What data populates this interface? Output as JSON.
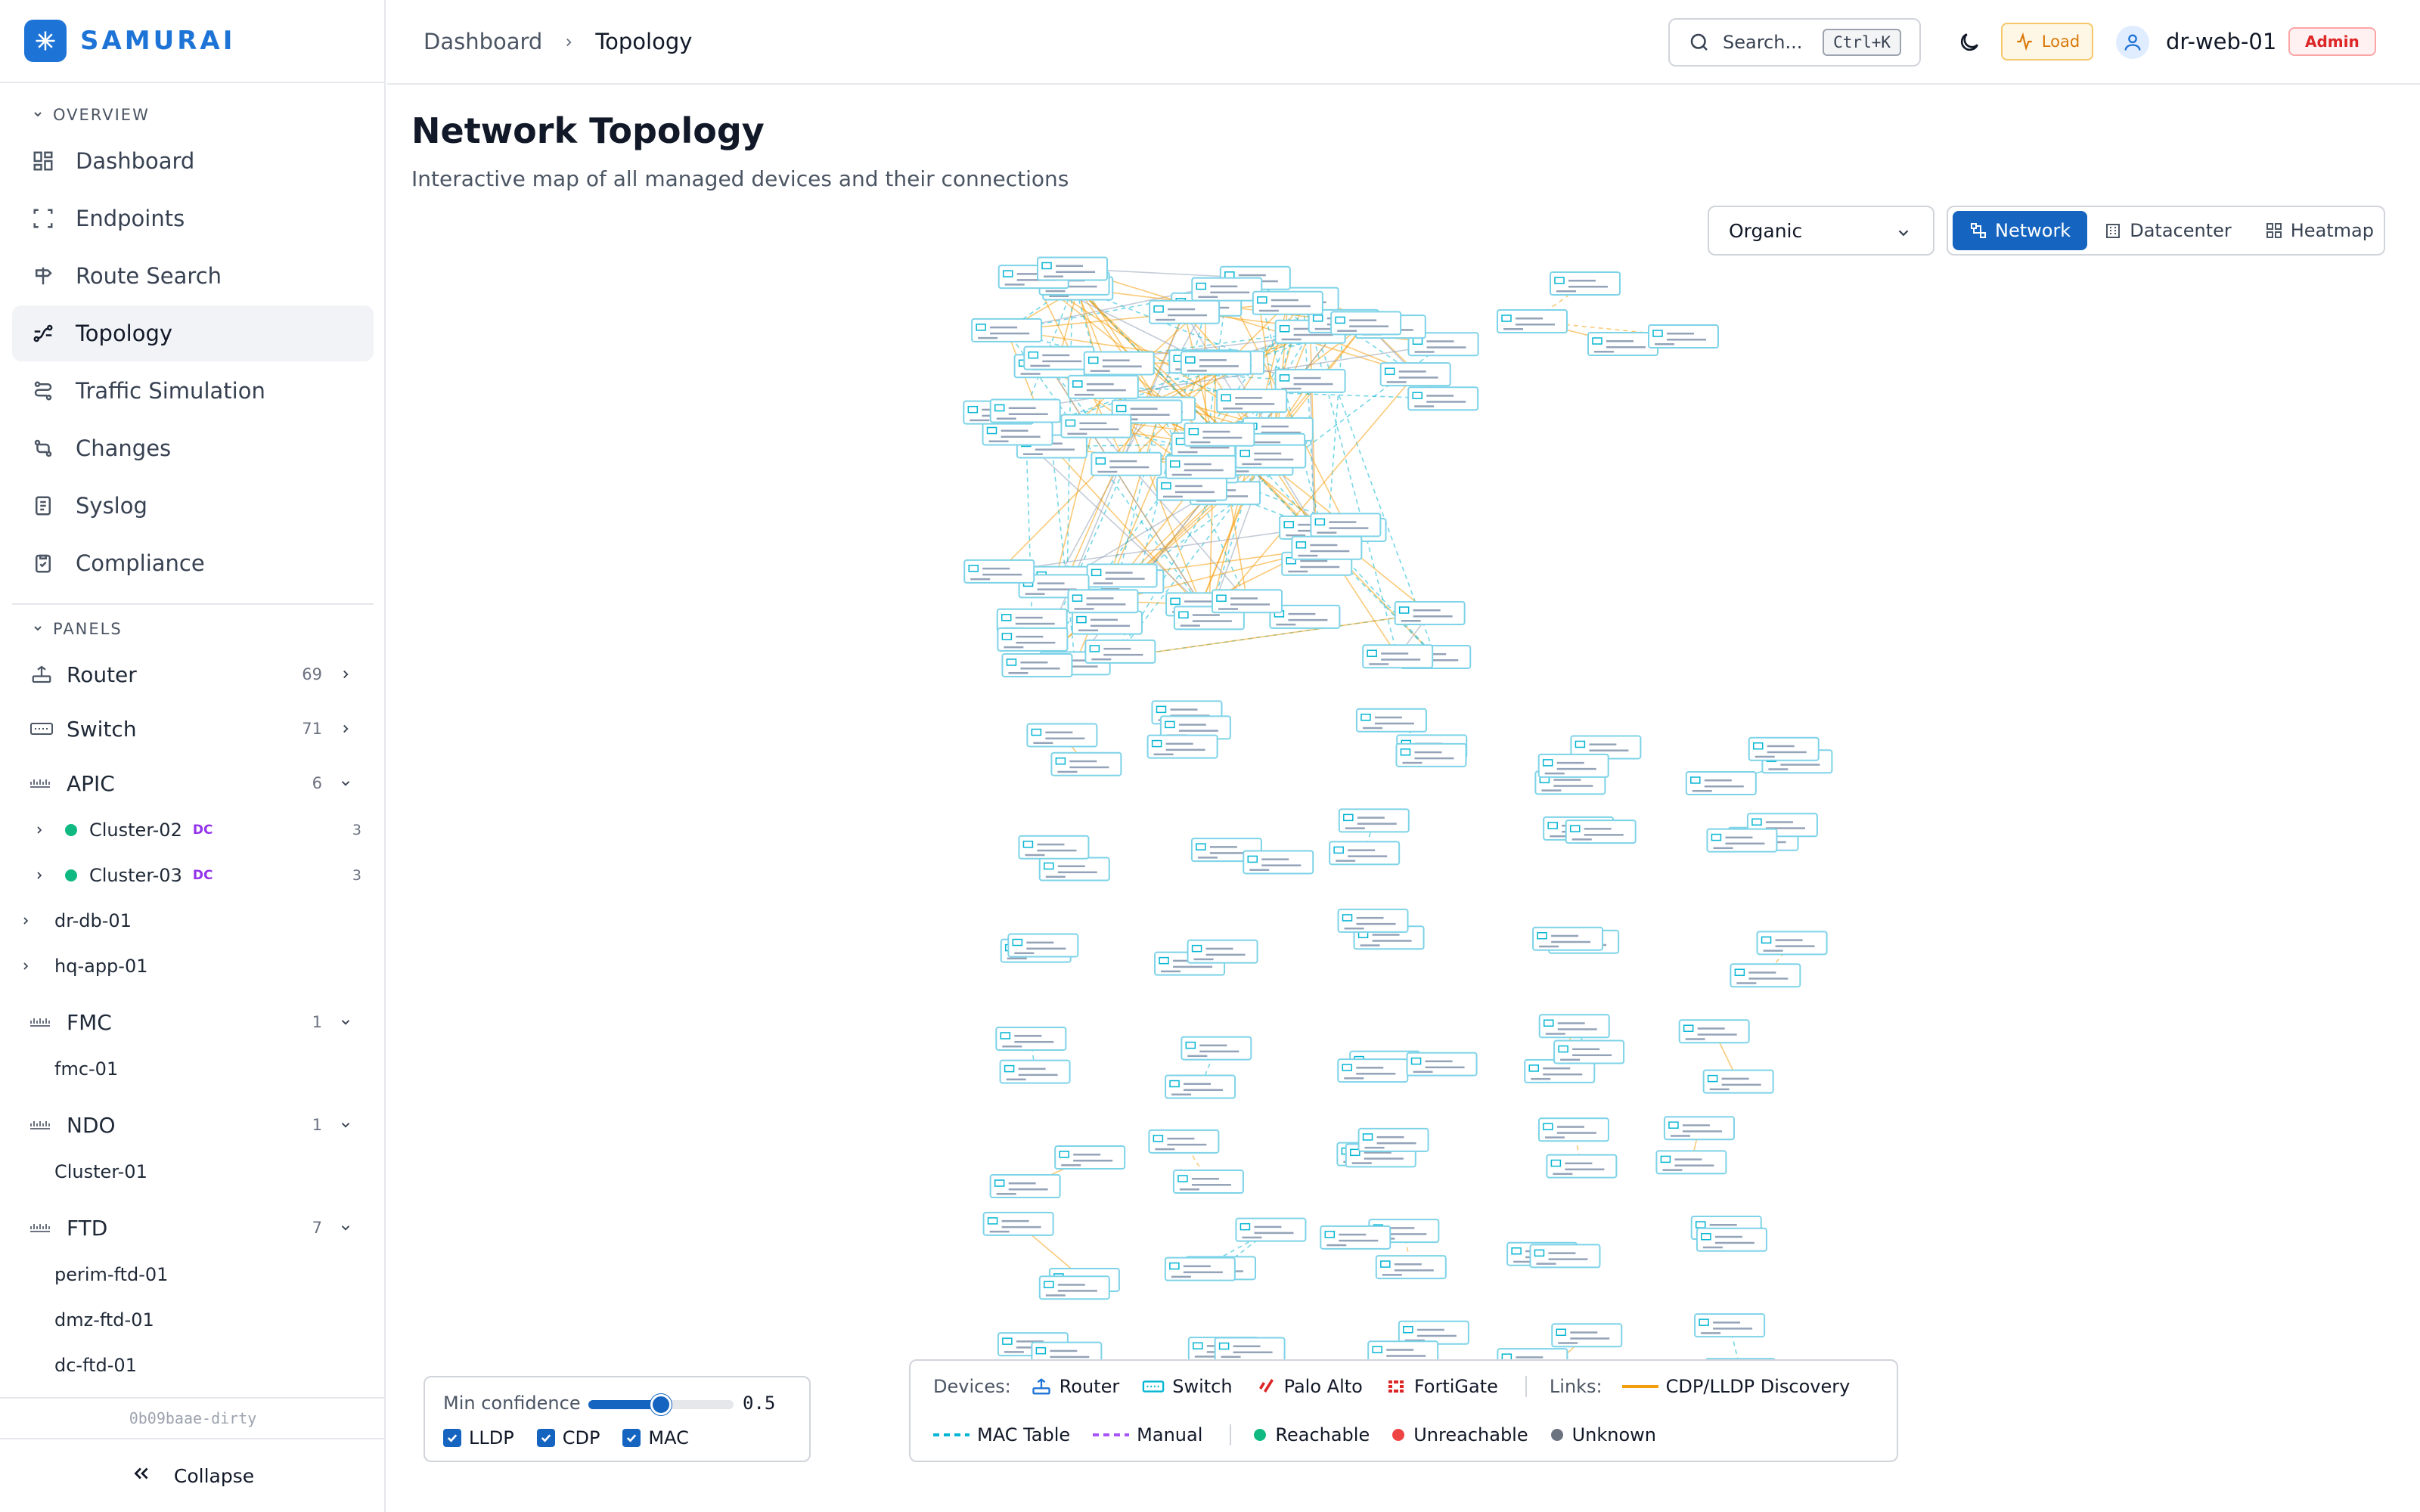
{
  "brand": {
    "name": "SAMURAI",
    "color": "#1e74d6"
  },
  "sidebar": {
    "overview_label": "OVERVIEW",
    "nav": [
      {
        "label": "Dashboard",
        "icon": "dashboard-grid-icon"
      },
      {
        "label": "Endpoints",
        "icon": "scan-icon"
      },
      {
        "label": "Route Search",
        "icon": "signpost-icon"
      },
      {
        "label": "Topology",
        "icon": "topology-icon",
        "active": true
      },
      {
        "label": "Traffic Simulation",
        "icon": "route-icon"
      },
      {
        "label": "Changes",
        "icon": "git-compare-icon"
      },
      {
        "label": "Syslog",
        "icon": "log-icon"
      },
      {
        "label": "Compliance",
        "icon": "clipboard-check-icon"
      }
    ],
    "panels_label": "PANELS",
    "panels": {
      "router": {
        "label": "Router",
        "count": "69"
      },
      "switch": {
        "label": "Switch",
        "count": "71"
      },
      "apic": {
        "label": "APIC",
        "count": "6",
        "vendor": "cisco"
      },
      "cluster02": {
        "label": "Cluster-02",
        "badge": "DC",
        "count": "3"
      },
      "cluster03": {
        "label": "Cluster-03",
        "badge": "DC",
        "count": "3"
      },
      "drdb": {
        "label": "dr-db-01"
      },
      "hqapp": {
        "label": "hq-app-01"
      },
      "fmc": {
        "label": "FMC",
        "count": "1",
        "vendor": "cisco"
      },
      "fmc01": {
        "label": "fmc-01"
      },
      "ndo": {
        "label": "NDO",
        "count": "1",
        "vendor": "cisco"
      },
      "ndocluster": {
        "label": "Cluster-01"
      },
      "ftd": {
        "label": "FTD",
        "count": "7",
        "vendor": "cisco"
      },
      "ftd1": {
        "label": "perim-ftd-01"
      },
      "ftd2": {
        "label": "dmz-ftd-01"
      },
      "ftd3": {
        "label": "dc-ftd-01"
      }
    },
    "version": "0b09baae-dirty",
    "collapse_label": "Collapse"
  },
  "header": {
    "breadcrumb": [
      "Dashboard",
      "Topology"
    ],
    "search_placeholder": "Search...",
    "search_shortcut": "Ctrl+K",
    "load_label": "Load",
    "user": "dr-web-01",
    "role": "Admin"
  },
  "main": {
    "title": "Network Topology",
    "subtitle": "Interactive map of all managed devices and their connections",
    "layout_value": "Organic",
    "views": [
      "Network",
      "Datacenter",
      "Heatmap"
    ],
    "active_view": "Network"
  },
  "confidence": {
    "label": "Min confidence",
    "value": "0.5",
    "level": 0.5,
    "checkboxes": [
      "LLDP",
      "CDP",
      "MAC"
    ]
  },
  "legend": {
    "devices_label": "Devices:",
    "devices": [
      "Router",
      "Switch",
      "Palo Alto",
      "FortiGate"
    ],
    "links_label": "Links:",
    "links": [
      "CDP/LLDP Discovery",
      "MAC Table",
      "Manual"
    ],
    "status": [
      "Reachable",
      "Unreachable",
      "Unknown"
    ]
  },
  "colors": {
    "accent": "#1565c0",
    "reachable": "#10b981",
    "unreachable": "#ef4444",
    "unknown": "#6b7280",
    "cdp_lldp": "#f59e0b",
    "mac": "#06b6d4",
    "manual": "#a855f7",
    "node_border": "#7dd3e8"
  }
}
